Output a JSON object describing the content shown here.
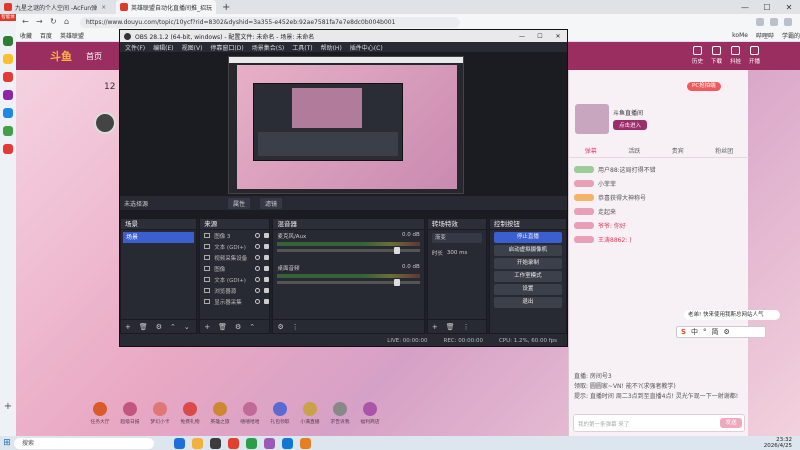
{
  "browser": {
    "tabs": [
      {
        "label": "九星之谜的个人空间 -AcFun弹",
        "color": "#e0392b"
      },
      {
        "label": "英雄联盟自动化直播间推_招玩",
        "color": "#e0392b"
      }
    ],
    "new_tab": "+",
    "url": "https://www.douyu.com/topic/10ycf?rid=8302&dyshid=3a355-e452eb:92ae7581fa7e7e8dc0b004b001",
    "bookmarks": [
      "收藏",
      "百度",
      "英雄联盟",
      "koMe",
      "哔哩哔",
      "学霸的"
    ],
    "badge": "智能体"
  },
  "site": {
    "logo": "斗鱼",
    "nav_home": "首页",
    "fav_count": "12",
    "header_icons": [
      "历史",
      "下载",
      "抖娃",
      "开播"
    ],
    "rank_button": "PC抢拍端",
    "gift_title": "斗鱼直播间",
    "gift_button": "点击进入",
    "chat_tabs": [
      "弹幕",
      "活跃",
      "贵宾",
      "粉丝团"
    ],
    "chat_lines": [
      {
        "text": "用户88:这局打得不错",
        "badge": "g"
      },
      {
        "text": "小菲菲",
        "badge": ""
      },
      {
        "text": "恭喜获得大神称号",
        "badge": "o"
      },
      {
        "text": "走起来",
        "badge": ""
      },
      {
        "text": "爷爷: 你好",
        "badge": "",
        "red": true
      },
      {
        "text": "王涛8862: )",
        "badge": "",
        "red": true
      },
      {
        "text": "",
        "badge": ""
      }
    ],
    "promo": [
      "直播: 房间号3",
      "领取: 圆圆家~VN! 能不?(求强者教学)",
      "提示: 直播时间 周二3点到至直播4点! 灵光乍现一下一射谢都!"
    ],
    "send_label": "发送",
    "chat_placeholder": "我的第一条弹幕 来了",
    "gifts": [
      {
        "name": "任务大厅",
        "color": "#d95b2b"
      },
      {
        "name": "超级日报",
        "color": "#c45580"
      },
      {
        "name": "梦幻小卡",
        "color": "#e07777"
      },
      {
        "name": "免费礼物",
        "color": "#d94a4a"
      },
      {
        "name": "英雄之旅",
        "color": "#cc8833"
      },
      {
        "name": "嘻嘻哈哈",
        "color": "#c06a9a"
      },
      {
        "name": "礼包领取",
        "color": "#5a6ad0"
      },
      {
        "name": "小满直播",
        "color": "#c9a24a"
      },
      {
        "name": "求告诉我",
        "color": "#888888"
      },
      {
        "name": "福利商店",
        "color": "#aa55aa"
      }
    ],
    "notice": "老弟! 快来使用我斯总网站人气",
    "ime": [
      "中",
      "°",
      "简",
      "⚙"
    ]
  },
  "obs": {
    "title": "OBS 28.1.2 (64-bit, windows) - 配置文件: 未命名 - 场景: 未命名",
    "menu": [
      "文件(F)",
      "编辑(E)",
      "视图(V)",
      "停靠窗口(D)",
      "场景集合(S)",
      "工具(T)",
      "帮助(H)",
      "插件中心(C)"
    ],
    "no_source": "未选择源",
    "properties": "属性",
    "filters": "滤镜",
    "docks": {
      "scenes": "场景",
      "sources": "来源",
      "mixer": "混音器",
      "transitions": "转场特效",
      "controls": "控制按钮"
    },
    "scene_name": "场景",
    "sources": [
      "图像 3",
      "文本 (GDI+)",
      "视频采集设备",
      "图像",
      "文本 (GDI+)",
      "浏览器源",
      "显示器采集"
    ],
    "mixer": [
      {
        "name": "麦克风/Aux",
        "db": "0.0 dB"
      },
      {
        "name": "桌面音频",
        "db": "0.0 dB"
      }
    ],
    "transition": {
      "value": "渐变",
      "label": "时长",
      "duration": "300 ms"
    },
    "controls": [
      "停止直播",
      "启动虚拟摄像机",
      "开始录制",
      "工作室模式",
      "设置",
      "退出"
    ],
    "status": {
      "live": "LIVE: 00:00:00",
      "rec": "REC: 00:00:00",
      "cpu": "CPU: 1.2%, 60.00 fps"
    }
  },
  "taskbar": {
    "search": "搜索",
    "time": "23:32",
    "date": "2026/4/25",
    "app_colors": [
      "#1e6fd9",
      "#f3b03a",
      "#3c3c3c",
      "#e43f2f",
      "#2b9e4b",
      "#9b59b6",
      "#0f78d4",
      "#e67e22"
    ]
  },
  "colors": {
    "brand": "#9a2e61",
    "accent": "#3b5ed1"
  }
}
